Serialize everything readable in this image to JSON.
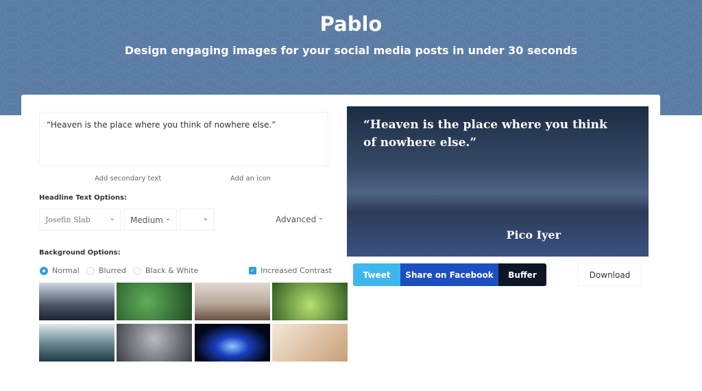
{
  "header": {
    "title": "Pablo",
    "subtitle": "Design engaging images for your social media posts in under 30 seconds"
  },
  "editor": {
    "headline_text": "“Heaven is the place where you think of  nowhere else.”",
    "add_secondary": "Add secondary text",
    "add_icon": "Add an icon"
  },
  "headline_options": {
    "label": "Headline Text Options:",
    "font": "Josefin Slab",
    "weight": "Medium",
    "size": "",
    "advanced": "Advanced"
  },
  "background_options": {
    "label": "Background Options:",
    "filters": [
      {
        "label": "Normal",
        "selected": true
      },
      {
        "label": "Blurred",
        "selected": false
      },
      {
        "label": "Black & White",
        "selected": false
      }
    ],
    "increased_contrast": {
      "label": "Increased Contrast",
      "checked": true
    }
  },
  "preview": {
    "quote": "“Heaven is the place where you think of nowhere else.”",
    "author": "Pico Iyer"
  },
  "share": {
    "tweet": "Tweet",
    "facebook": "Share on Facebook",
    "buffer": "Buffer",
    "download": "Download"
  },
  "colors": {
    "header": "#5b7ca5",
    "tweet": "#3fb6ee",
    "facebook": "#1d4fc3",
    "buffer": "#0c1626",
    "accent": "#2a9fd8"
  }
}
